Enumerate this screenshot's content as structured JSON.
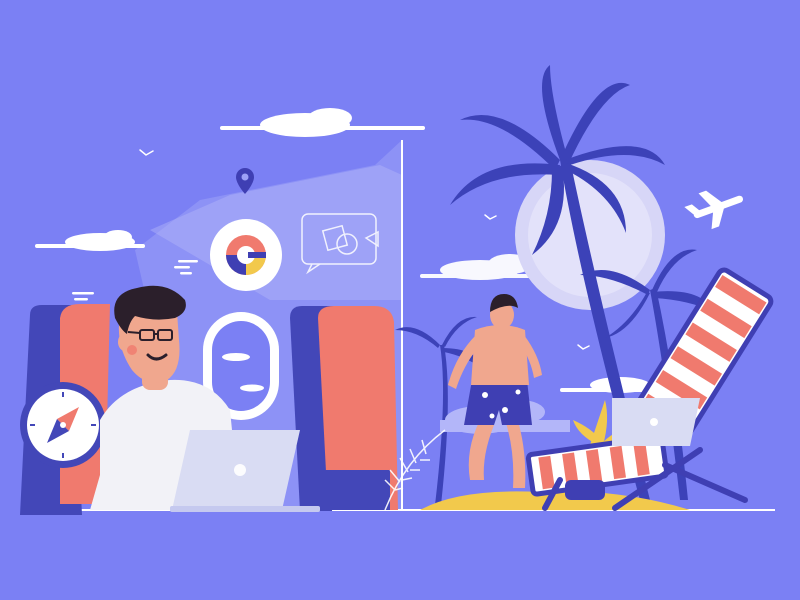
{
  "scene": {
    "description_visible_text": "",
    "colors": {
      "background": "#7b80f4",
      "cloud_white": "#ffffff",
      "navy": "#3f3fb3",
      "seat_coral": "#f07a6e",
      "seat_navy": "#4347b8",
      "skin": "#f0a78e",
      "shirt": "#f2f2f7",
      "hair": "#2b1f2b",
      "laptop": "#d9dcf3",
      "sun_disc": "#d7d6f7",
      "sand": "#f2c94c",
      "stripe_red": "#f07a6e",
      "palm": "#3c42b8",
      "glass_window": "#a8acf6"
    },
    "icons": [
      "location-pin-icon",
      "pie-chart-icon",
      "media-gallery-icon",
      "compass-icon",
      "airplane-icon",
      "laptop-icon",
      "palm-tree-icon",
      "sun-icon",
      "beach-chair-icon"
    ]
  }
}
